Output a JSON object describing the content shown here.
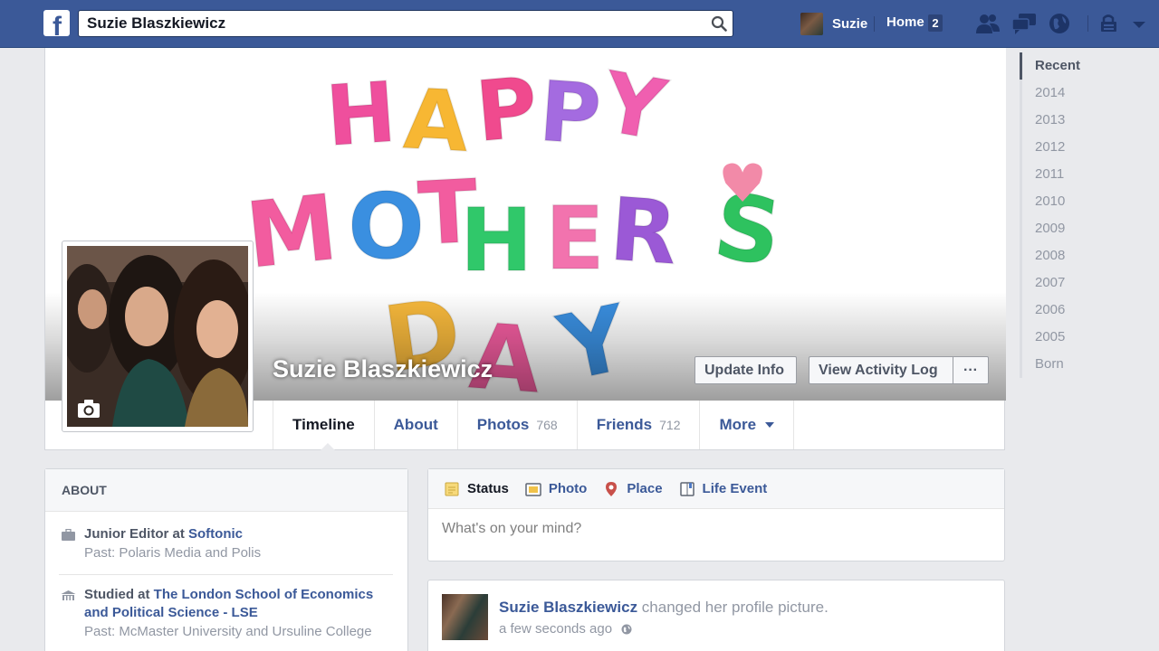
{
  "topbar": {
    "search_value": "Suzie Blaszkiewicz",
    "user_name": "Suzie",
    "home_label": "Home",
    "home_count": "2"
  },
  "cover": {
    "text_lines": [
      "HAPPY",
      "MOTHER'S",
      "DAY"
    ],
    "profile_name": "Suzie Blaszkiewicz",
    "buttons": {
      "update_info": "Update Info",
      "view_activity_log": "View Activity Log",
      "more": "···"
    }
  },
  "tabs": [
    {
      "label": "Timeline"
    },
    {
      "label": "About"
    },
    {
      "label": "Photos",
      "count": "768"
    },
    {
      "label": "Friends",
      "count": "712"
    },
    {
      "label": "More"
    }
  ],
  "years": [
    "Recent",
    "2014",
    "2013",
    "2012",
    "2011",
    "2010",
    "2009",
    "2008",
    "2007",
    "2006",
    "2005",
    "Born"
  ],
  "about": {
    "heading": "ABOUT",
    "work": {
      "prefix": "Junior Editor at ",
      "link": "Softonic",
      "past": "Past: Polaris Media and Polis"
    },
    "education": {
      "prefix": "Studied at ",
      "link": "The London School of Economics and Political Science - LSE",
      "past": "Past: McMaster University and Ursuline College"
    }
  },
  "composer": {
    "tabs": [
      "Status",
      "Photo",
      "Place",
      "Life Event"
    ],
    "placeholder": "What's on your mind?"
  },
  "story": {
    "name": "Suzie Blaszkiewicz",
    "action": " changed her profile picture.",
    "time": "a few seconds ago"
  },
  "colors": {
    "brand": "#3b5998",
    "link": "#3b5998",
    "muted": "#9197a3",
    "background": "#e9eaed"
  }
}
